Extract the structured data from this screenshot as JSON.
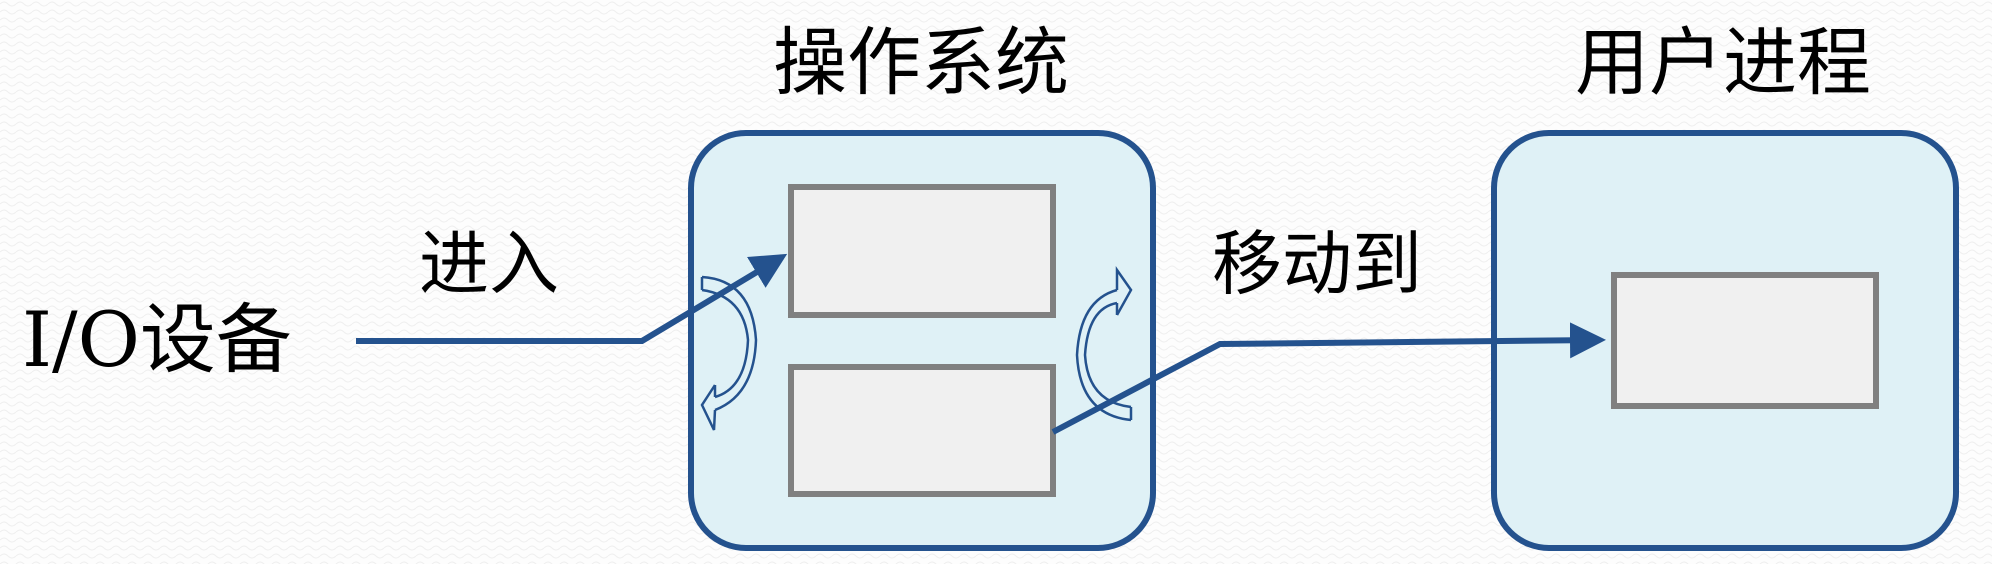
{
  "titles": {
    "os": "操作系统",
    "user_process": "用户进程"
  },
  "labels": {
    "io_device": "I/O设备",
    "enter": "进入",
    "move_to": "移动到"
  },
  "colors": {
    "container_border": "#24528e",
    "container_fill": "#dff1f6",
    "buffer_border": "#808080",
    "buffer_fill": "#f0f0f0",
    "arrow": "#24528e"
  }
}
